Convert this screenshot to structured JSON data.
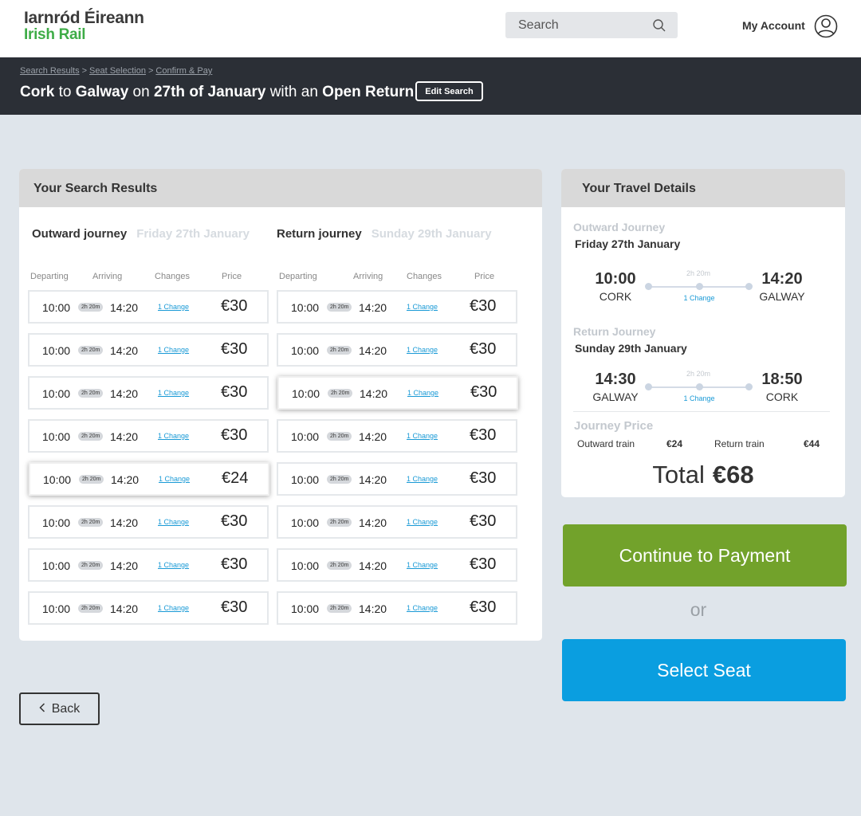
{
  "header": {
    "logo_line1": "Iarnród Éireann",
    "logo_line2": "Irish Rail",
    "search_placeholder": "Search",
    "my_account": "My Account"
  },
  "banner": {
    "breadcrumbs": [
      "Search Results",
      "Seat Selection",
      "Confirm & Pay"
    ],
    "breadcrumb_sep": ">",
    "origin": "Cork",
    "to": "to",
    "destination": "Galway",
    "on": "on",
    "date": "27th of January",
    "with_an": "with an",
    "ticket_type": "Open Return",
    "edit_search": "Edit Search"
  },
  "results": {
    "title": "Your Search Results",
    "outward": {
      "label": "Outward journey",
      "date": "Friday 27th January"
    },
    "return": {
      "label": "Return  journey",
      "date": "Sunday 29th January"
    },
    "columns": [
      "Departing",
      "Arriving",
      "Changes",
      "Price"
    ],
    "outward_rows": [
      {
        "dep": "10:00",
        "dur": "2h 20m",
        "arr": "14:20",
        "chg": "1 Change",
        "price": "€30"
      },
      {
        "dep": "10:00",
        "dur": "2h 20m",
        "arr": "14:20",
        "chg": "1 Change",
        "price": "€30"
      },
      {
        "dep": "10:00",
        "dur": "2h 20m",
        "arr": "14:20",
        "chg": "1 Change",
        "price": "€30"
      },
      {
        "dep": "10:00",
        "dur": "2h 20m",
        "arr": "14:20",
        "chg": "1 Change",
        "price": "€30"
      },
      {
        "dep": "10:00",
        "dur": "2h 20m",
        "arr": "14:20",
        "chg": "1 Change",
        "price": "€24",
        "selected": true
      },
      {
        "dep": "10:00",
        "dur": "2h 20m",
        "arr": "14:20",
        "chg": "1 Change",
        "price": "€30"
      },
      {
        "dep": "10:00",
        "dur": "2h 20m",
        "arr": "14:20",
        "chg": "1 Change",
        "price": "€30"
      },
      {
        "dep": "10:00",
        "dur": "2h 20m",
        "arr": "14:20",
        "chg": "1 Change",
        "price": "€30"
      }
    ],
    "return_rows": [
      {
        "dep": "10:00",
        "dur": "2h 20m",
        "arr": "14:20",
        "chg": "1 Change",
        "price": "€30"
      },
      {
        "dep": "10:00",
        "dur": "2h 20m",
        "arr": "14:20",
        "chg": "1 Change",
        "price": "€30"
      },
      {
        "dep": "10:00",
        "dur": "2h 20m",
        "arr": "14:20",
        "chg": "1 Change",
        "price": "€30",
        "selected": true
      },
      {
        "dep": "10:00",
        "dur": "2h 20m",
        "arr": "14:20",
        "chg": "1 Change",
        "price": "€30"
      },
      {
        "dep": "10:00",
        "dur": "2h 20m",
        "arr": "14:20",
        "chg": "1 Change",
        "price": "€30"
      },
      {
        "dep": "10:00",
        "dur": "2h 20m",
        "arr": "14:20",
        "chg": "1 Change",
        "price": "€30"
      },
      {
        "dep": "10:00",
        "dur": "2h 20m",
        "arr": "14:20",
        "chg": "1 Change",
        "price": "€30"
      },
      {
        "dep": "10:00",
        "dur": "2h 20m",
        "arr": "14:20",
        "chg": "1 Change",
        "price": "€30"
      }
    ]
  },
  "details": {
    "title": "Your Travel Details",
    "outward": {
      "label": "Outward Journey",
      "date": "Friday 27th January",
      "dep_time": "10:00",
      "dep_station": "CORK",
      "arr_time": "14:20",
      "arr_station": "GALWAY",
      "duration": "2h 20m",
      "changes": "1 Change"
    },
    "return": {
      "label": "Return Journey",
      "date": "Sunday 29th January",
      "dep_time": "14:30",
      "dep_station": "GALWAY",
      "arr_time": "18:50",
      "arr_station": "CORK",
      "duration": "2h 20m",
      "changes": "1 Change"
    },
    "journey_price_label": "Journey Price",
    "outward_train_label": "Outward train",
    "outward_train_price": "€24",
    "return_train_label": "Return train",
    "return_train_price": "€44",
    "total_label": "Total",
    "total_value": "€68"
  },
  "actions": {
    "continue": "Continue to Payment",
    "or": "or",
    "select_seat": "Select Seat",
    "back": "Back"
  },
  "colors": {
    "brand_green": "#3eac47",
    "banner_bg": "#2b2f36",
    "continue_bg": "#72a22b",
    "seat_bg": "#0a9ee0",
    "link_blue": "#1a9ad6"
  },
  "icons": {
    "search": "search-icon",
    "account": "user-icon",
    "back": "chevron-left-icon"
  }
}
